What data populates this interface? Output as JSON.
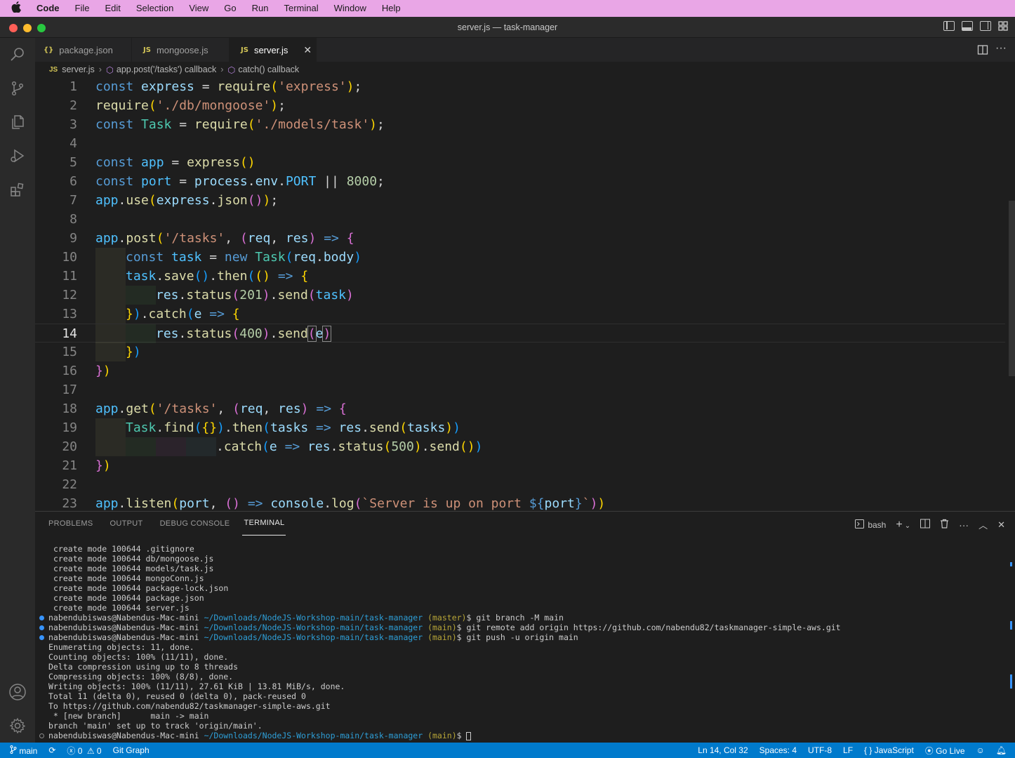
{
  "menubar": {
    "app_name": "Code",
    "items": [
      "File",
      "Edit",
      "Selection",
      "View",
      "Go",
      "Run",
      "Terminal",
      "Window",
      "Help"
    ]
  },
  "window": {
    "title": "server.js — task-manager"
  },
  "tabs": [
    {
      "label": "package.json",
      "icon": "{}"
    },
    {
      "label": "mongoose.js",
      "icon": "JS"
    },
    {
      "label": "server.js",
      "icon": "JS",
      "active": true
    }
  ],
  "breadcrumb": {
    "icon": "JS",
    "file": "server.js",
    "parts": [
      "app.post('/tasks') callback",
      "catch() callback"
    ]
  },
  "editor": {
    "line_numbers": [
      "1",
      "2",
      "3",
      "4",
      "5",
      "6",
      "7",
      "8",
      "9",
      "10",
      "11",
      "12",
      "13",
      "14",
      "15",
      "16",
      "17",
      "18",
      "19",
      "20",
      "21",
      "22",
      "23"
    ],
    "current_line": "14"
  },
  "panel": {
    "tabs": [
      "PROBLEMS",
      "OUTPUT",
      "DEBUG CONSOLE",
      "TERMINAL"
    ],
    "active_tab": "TERMINAL",
    "shell": "bash",
    "prompt_user": "nabendubiswas@Nabendus-Mac-mini",
    "prompt_path": "~/Downloads/NodeJS-Workshop-main/task-manager",
    "terminal_lines": [
      "create mode 100644 .gitignore",
      "create mode 100644 db/mongoose.js",
      "create mode 100644 models/task.js",
      "create mode 100644 mongoConn.js",
      "create mode 100644 package-lock.json",
      "create mode 100644 package.json",
      "create mode 100644 server.js"
    ],
    "commands": [
      {
        "branch": "(master)",
        "cmd": "$ git branch -M main"
      },
      {
        "branch": "(main)",
        "cmd": "$ git remote add origin https://github.com/nabendu82/taskmanager-simple-aws.git"
      },
      {
        "branch": "(main)",
        "cmd": "$ git push -u origin main"
      }
    ],
    "output_lines": [
      "Enumerating objects: 11, done.",
      "Counting objects: 100% (11/11), done.",
      "Delta compression using up to 8 threads",
      "Compressing objects: 100% (8/8), done.",
      "Writing objects: 100% (11/11), 27.61 KiB | 13.81 MiB/s, done.",
      "Total 11 (delta 0), reused 0 (delta 0), pack-reused 0",
      "To https://github.com/nabendu82/taskmanager-simple-aws.git",
      " * [new branch]      main -> main",
      "branch 'main' set up to track 'origin/main'."
    ],
    "last_prompt": {
      "branch": "(main)",
      "cmd": "$ "
    }
  },
  "statusbar": {
    "branch": "main",
    "errors": "0",
    "warnings": "0",
    "git_graph": "Git Graph",
    "position": "Ln 14, Col 32",
    "spaces": "Spaces: 4",
    "encoding": "UTF-8",
    "eol": "LF",
    "language": "JavaScript",
    "go_live": "Go Live"
  },
  "colors": {
    "menubar_bg": "#e9a6e6",
    "statusbar_bg": "#007acc",
    "editor_bg": "#1e1e1e",
    "activitybar_bg": "#2a2a2a",
    "terminal_path": "#2e9fd8",
    "terminal_branch": "#b8a637",
    "terminal_dot_done": "#3794ff"
  },
  "icons": [
    "apple-icon",
    "search-icon",
    "source-control-icon",
    "explorer-icon",
    "run-debug-icon",
    "extensions-icon",
    "account-icon",
    "settings-gear-icon",
    "split-editor-icon",
    "more-actions-icon",
    "close-icon",
    "terminal-icon",
    "add-terminal-icon",
    "split-terminal-icon",
    "trash-icon",
    "chevron-up-icon",
    "git-branch-icon",
    "sync-icon",
    "error-icon",
    "warning-icon",
    "broadcast-icon",
    "feedback-icon",
    "bell-icon"
  ]
}
